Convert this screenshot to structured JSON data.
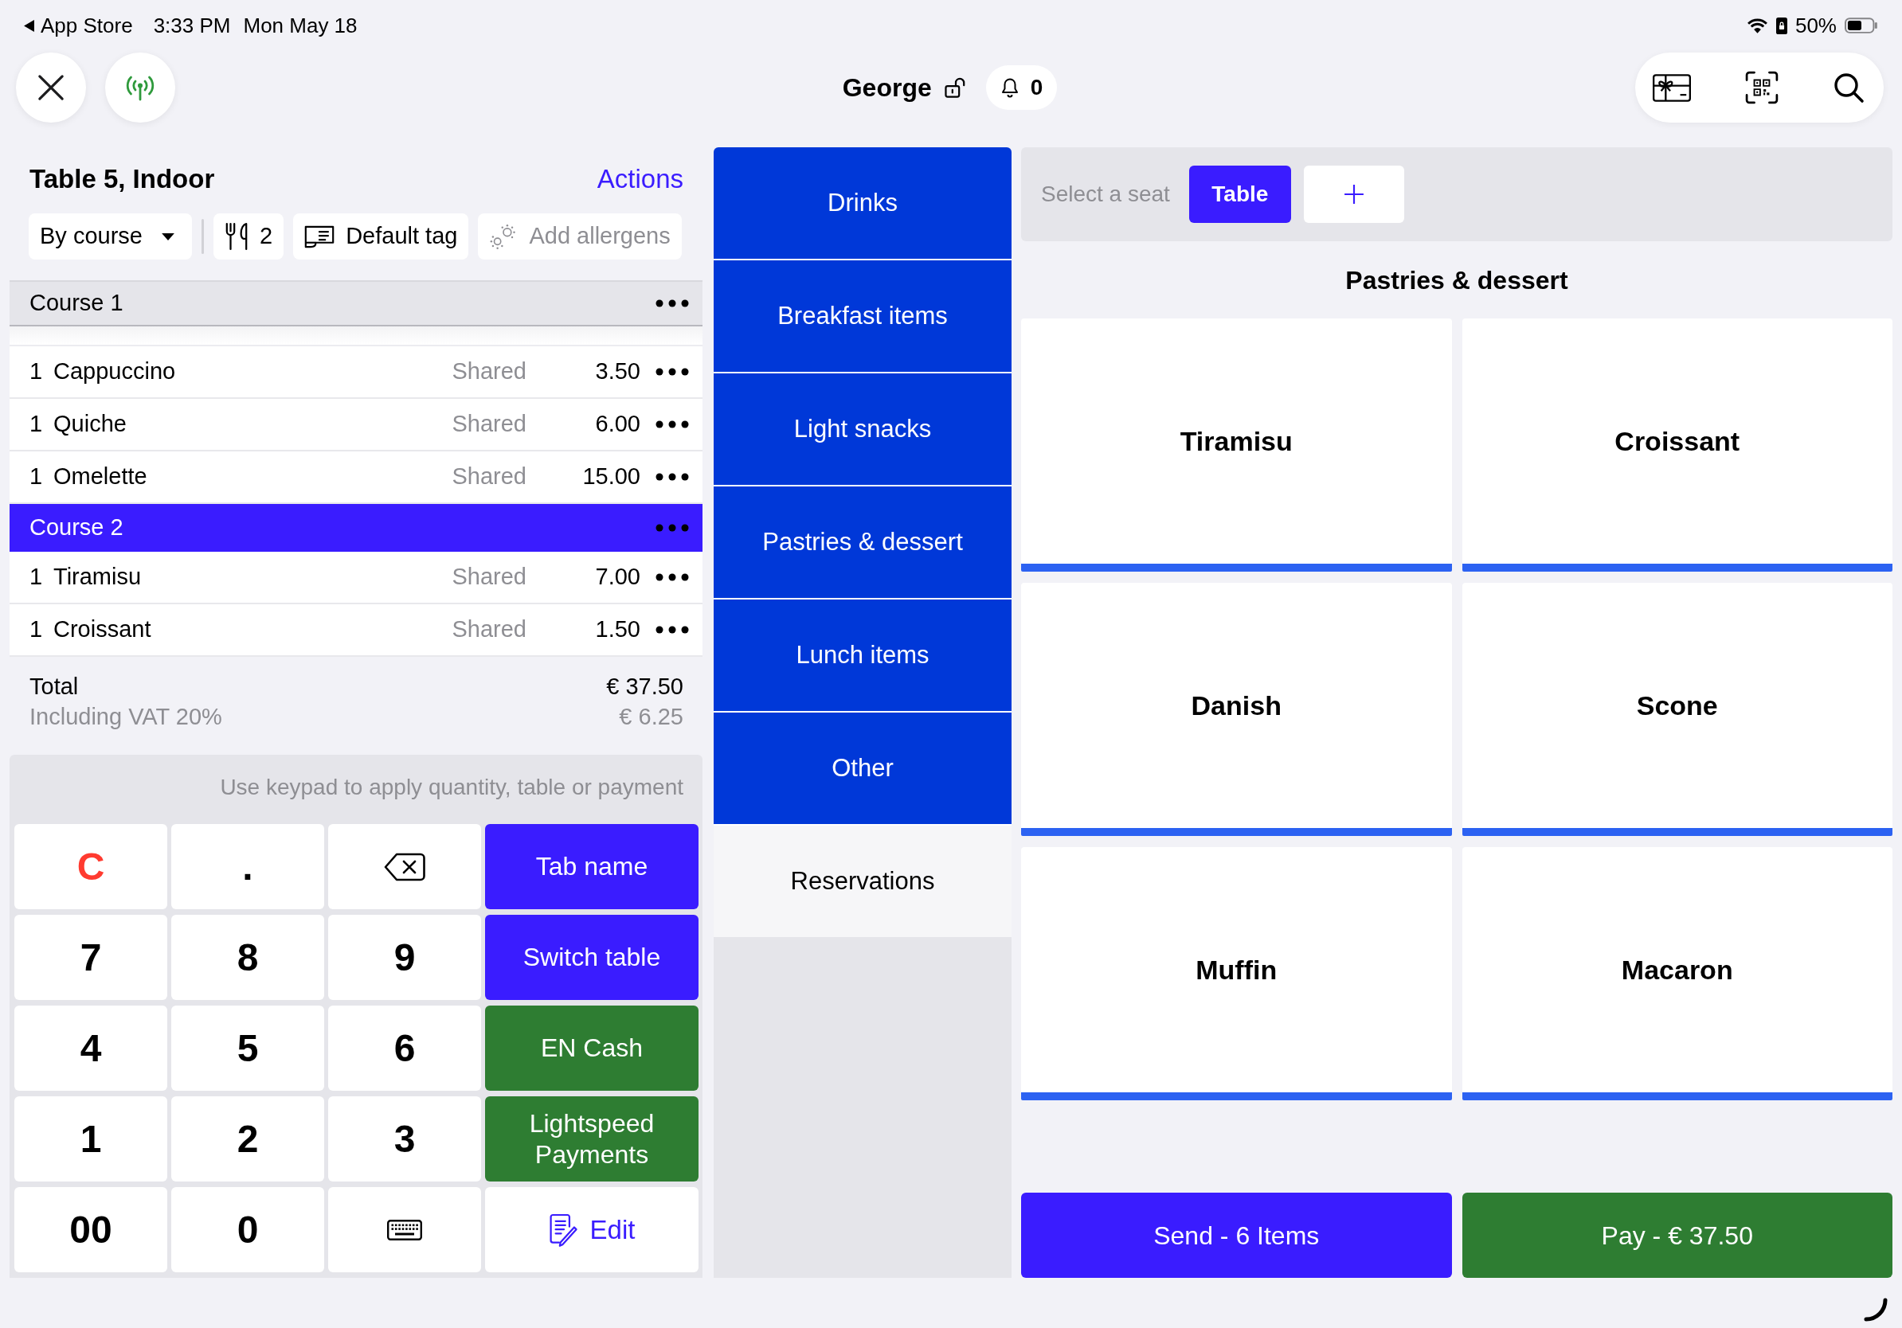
{
  "status_bar": {
    "back_label": "App Store",
    "time": "3:33 PM",
    "date": "Mon May 18",
    "battery": "50%"
  },
  "top_bar": {
    "user": "George",
    "notifications": "0"
  },
  "order": {
    "title": "Table 5, Indoor",
    "actions": "Actions",
    "grouping": "By course",
    "guests": "2",
    "tag": "Default tag",
    "allergens": "Add allergens",
    "courses": [
      {
        "name": "Course 1",
        "selected": false,
        "items": [
          {
            "qty": "1",
            "name": "Cappuccino",
            "seat": "Shared",
            "price": "3.50"
          },
          {
            "qty": "1",
            "name": "Quiche",
            "seat": "Shared",
            "price": "6.00"
          },
          {
            "qty": "1",
            "name": "Omelette",
            "seat": "Shared",
            "price": "15.00"
          }
        ]
      },
      {
        "name": "Course 2",
        "selected": true,
        "items": [
          {
            "qty": "1",
            "name": "Tiramisu",
            "seat": "Shared",
            "price": "7.00"
          },
          {
            "qty": "1",
            "name": "Croissant",
            "seat": "Shared",
            "price": "1.50"
          }
        ]
      }
    ],
    "total_label": "Total",
    "total": "€ 37.50",
    "vat_label": "Including VAT 20%",
    "vat": "€ 6.25"
  },
  "keypad": {
    "hint": "Use keypad to apply quantity, table or payment",
    "keys": [
      {
        "kind": "clear",
        "label": "C"
      },
      {
        "kind": "digit",
        "label": "."
      },
      {
        "kind": "backspace"
      },
      {
        "kind": "primary",
        "label": "Tab name"
      },
      {
        "kind": "digit",
        "label": "7"
      },
      {
        "kind": "digit",
        "label": "8"
      },
      {
        "kind": "digit",
        "label": "9"
      },
      {
        "kind": "primary",
        "label": "Switch table"
      },
      {
        "kind": "digit",
        "label": "4"
      },
      {
        "kind": "digit",
        "label": "5"
      },
      {
        "kind": "digit",
        "label": "6"
      },
      {
        "kind": "payment",
        "label": "EN Cash"
      },
      {
        "kind": "digit",
        "label": "1"
      },
      {
        "kind": "digit",
        "label": "2"
      },
      {
        "kind": "digit",
        "label": "3"
      },
      {
        "kind": "payment",
        "label": "Lightspeed Payments"
      },
      {
        "kind": "digit",
        "label": "00"
      },
      {
        "kind": "digit",
        "label": "0"
      },
      {
        "kind": "keyboard"
      },
      {
        "kind": "edit",
        "label": "Edit"
      }
    ]
  },
  "categories": [
    {
      "kind": "category",
      "label": "Drinks"
    },
    {
      "kind": "category",
      "label": "Breakfast items"
    },
    {
      "kind": "category",
      "label": "Light snacks"
    },
    {
      "kind": "category",
      "label": "Pastries & dessert"
    },
    {
      "kind": "category",
      "label": "Lunch items"
    },
    {
      "kind": "category",
      "label": "Other"
    },
    {
      "kind": "reservations",
      "label": "Reservations"
    }
  ],
  "seats": {
    "label": "Select a seat",
    "options": [
      {
        "label": "Table",
        "selected": true
      }
    ]
  },
  "products": {
    "heading": "Pastries & dessert",
    "items": [
      "Tiramisu",
      "Croissant",
      "Danish",
      "Scone",
      "Muffin",
      "Macaron"
    ]
  },
  "footer": {
    "send": "Send - 6 Items",
    "pay": "Pay - € 37.50"
  }
}
